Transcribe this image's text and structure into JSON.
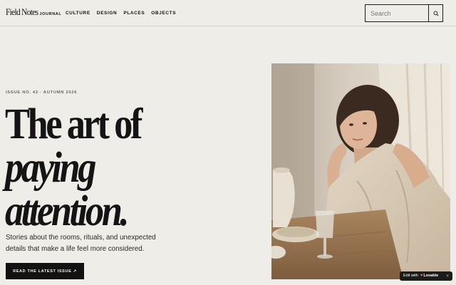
{
  "header": {
    "brand": "Field Notes",
    "brand_sub": "JOURNAL",
    "nav": [
      "CULTURE",
      "DESIGN",
      "PLACES",
      "OBJECTS"
    ],
    "search_placeholder": "Search",
    "search_value": ""
  },
  "hero": {
    "eyebrow": "ISSUE NO. 42 · AUTUMN 2026",
    "headline": [
      "The art of",
      "paying",
      "attention."
    ],
    "lede": "Stories about the rooms, rituals, and unexpected details that make a life feel more considered.",
    "cta_label": "READ THE LATEST ISSUE ↗"
  },
  "badge": {
    "prefix": "Edit with",
    "heart": "♥",
    "brand": "Lovable",
    "close": "×"
  },
  "colors": {
    "background": "#efede8",
    "ink": "#141414",
    "muted": "#6a6862",
    "button": "#121212"
  }
}
